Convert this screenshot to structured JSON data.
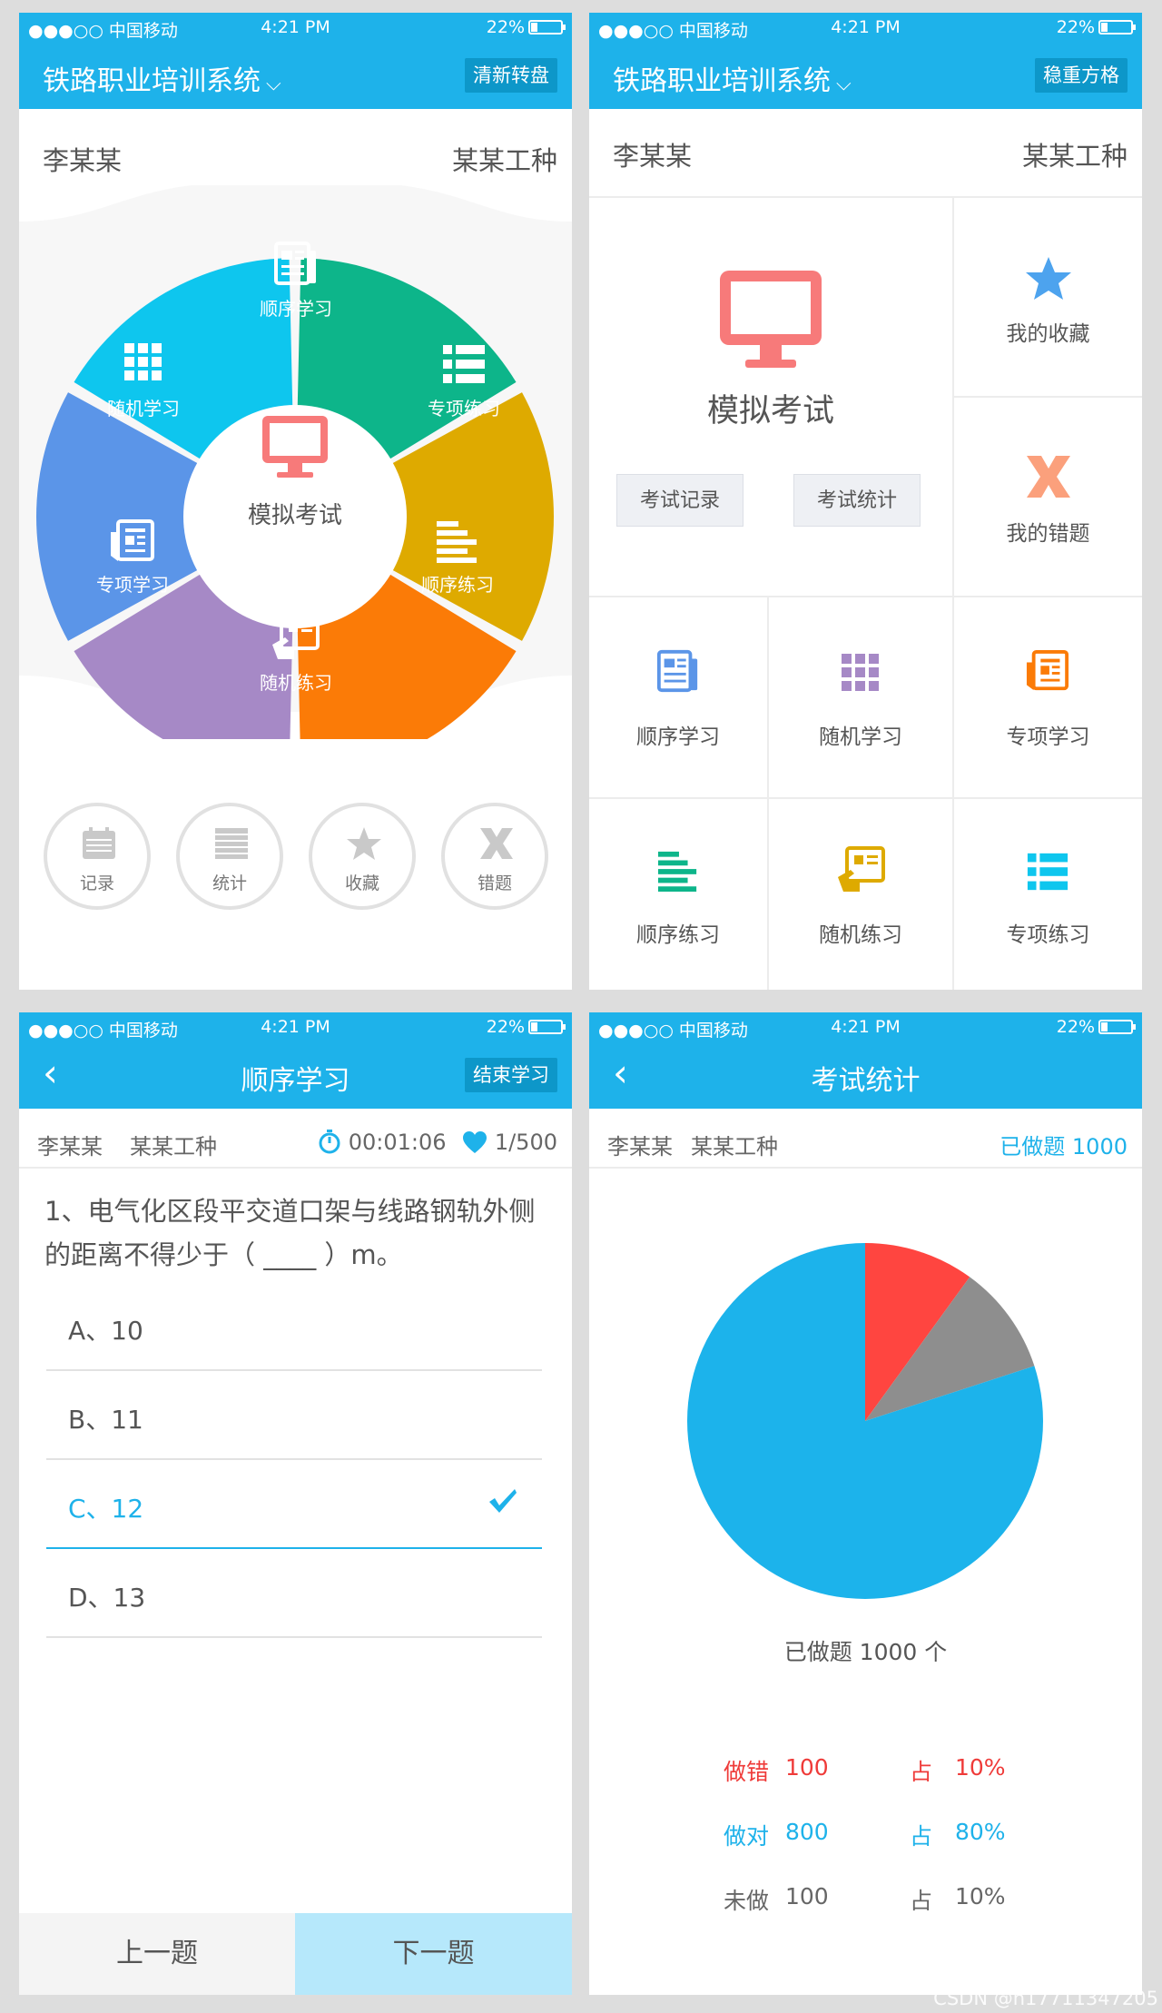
{
  "status": {
    "carrier": "●●●○○ 中国移动 ",
    "time": "4:21 PM",
    "battery": "22%"
  },
  "screen1": {
    "title": "铁路职业培训系统",
    "action": "清新转盘",
    "user": "李某某",
    "job": "某某工种",
    "wheel": [
      {
        "label": "顺序学习",
        "color": "#5b95e8",
        "icon": "newspaper-icon"
      },
      {
        "label": "专项练习",
        "color": "#0ec6ee",
        "icon": "list-icon"
      },
      {
        "label": "顺序练习",
        "color": "#0db58a",
        "icon": "bars-icon"
      },
      {
        "label": "随机练习",
        "color": "#deaa00",
        "icon": "tablet-hand-icon"
      },
      {
        "label": "专项学习",
        "color": "#fb7b07",
        "icon": "doc-icon"
      },
      {
        "label": "随机学习",
        "color": "#a689c6",
        "icon": "grid-icon"
      }
    ],
    "center": "模拟考试",
    "shortcuts": [
      "记录",
      "统计",
      "收藏",
      "错题"
    ]
  },
  "screen2": {
    "title": "铁路职业培训系统",
    "action": "稳重方格",
    "user": "李某某",
    "job": "某某工种",
    "exam": "模拟考试",
    "exam_record": "考试记录",
    "exam_stats": "考试统计",
    "favorites": "我的收藏",
    "mistakes": "我的错题",
    "cells": [
      "顺序学习",
      "随机学习",
      "专项学习",
      "顺序练习",
      "随机练习",
      "专项练习"
    ]
  },
  "screen3": {
    "title": "顺序学习",
    "action": "结束学习",
    "user": "李某某",
    "job": "某某工种",
    "timer": "00:01:06",
    "progress": "1/500",
    "question": "1、电气化区段平交道口架与线路钢轨外侧的距离不得少于（ ____ ）m。",
    "options": [
      "A、10",
      "B、11",
      "C、12",
      "D、13"
    ],
    "selected_index": 2,
    "prev": "上一题",
    "next": "下一题"
  },
  "screen4": {
    "title": "考试统计",
    "user": "李某某",
    "job": "某某工种",
    "done_summary": "已做题 1000",
    "caption": "已做题 1000 个",
    "stats": [
      {
        "label": "做错",
        "count": "100",
        "pct_label": "占",
        "pct": "10%",
        "color": "#ef3b39"
      },
      {
        "label": "做对",
        "count": "800",
        "pct_label": "占",
        "pct": "80%",
        "color": "#1eb2ea"
      },
      {
        "label": "未做",
        "count": "100",
        "pct_label": "占",
        "pct": "10%",
        "color": "#666666"
      }
    ]
  },
  "chart_data": {
    "type": "pie",
    "categories": [
      "做错",
      "未做",
      "做对"
    ],
    "values": [
      100,
      100,
      800
    ],
    "colors": [
      "#ff4540",
      "#8e8e8e",
      "#1cb3eb"
    ]
  },
  "watermark": "CSDN @h17711347205"
}
